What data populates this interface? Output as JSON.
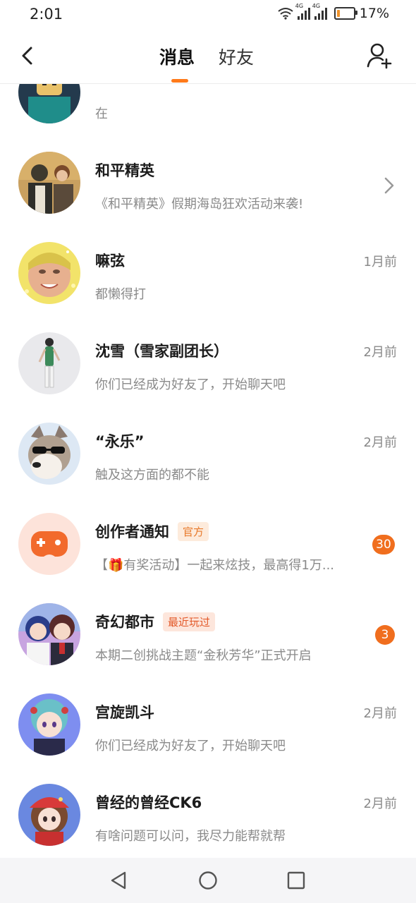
{
  "status_bar": {
    "time": "2:01",
    "network_1": "4G",
    "network_2": "4G",
    "battery_text": "17%",
    "battery_level": 0.17,
    "battery_color": "#f0932b"
  },
  "header": {
    "tabs": [
      {
        "label": "消息",
        "active": true
      },
      {
        "label": "好友",
        "active": false
      }
    ],
    "back_icon": "chevron-left-icon",
    "add_friend_icon": "person-add-icon",
    "accent_color": "#ff7a1a"
  },
  "conversations": [
    {
      "name": "",
      "preview": "在",
      "time": "",
      "avatar_icon": "blocky-avatar-icon"
    },
    {
      "name": "和平精英",
      "preview": "《和平精英》假期海岛狂欢活动来袭!",
      "time": "",
      "avatar_icon": "game-soldiers-icon",
      "chevron": true
    },
    {
      "name": "嘛弦",
      "preview": "都懒得打",
      "time": "1月前",
      "avatar_icon": "sparkle-face-icon"
    },
    {
      "name": "沈雪（雪家副团长）",
      "preview": "你们已经成为好友了，开始聊天吧",
      "time": "2月前",
      "avatar_icon": "standing-figure-icon"
    },
    {
      "name": "“永乐”",
      "preview": "触及这方面的都不能",
      "time": "2月前",
      "avatar_icon": "dog-sunglasses-icon"
    },
    {
      "name": "创作者通知",
      "tag": "官方",
      "preview": "【🎁有奖活动】一起来炫技，最高得1万...",
      "time": "",
      "badge": "30",
      "avatar_icon": "gamepad-icon"
    },
    {
      "name": "奇幻都市",
      "tag": "最近玩过",
      "preview": "本期二创挑战主题“金秋芳华”正式开启",
      "time": "",
      "badge": "3",
      "avatar_icon": "anime-duo-icon"
    },
    {
      "name": "宫旋凯斗",
      "preview": "你们已经成为好友了，开始聊天吧",
      "time": "2月前",
      "avatar_icon": "anime-girl-icon"
    },
    {
      "name": "曾经的曾经CK6",
      "preview": "有啥问题可以问，我尽力能帮就帮",
      "time": "2月前",
      "avatar_icon": "anime-girl-red-hat-icon"
    }
  ],
  "nav_bar": {
    "back": "triangle-back-icon",
    "home": "circle-home-icon",
    "recents": "square-recents-icon"
  }
}
